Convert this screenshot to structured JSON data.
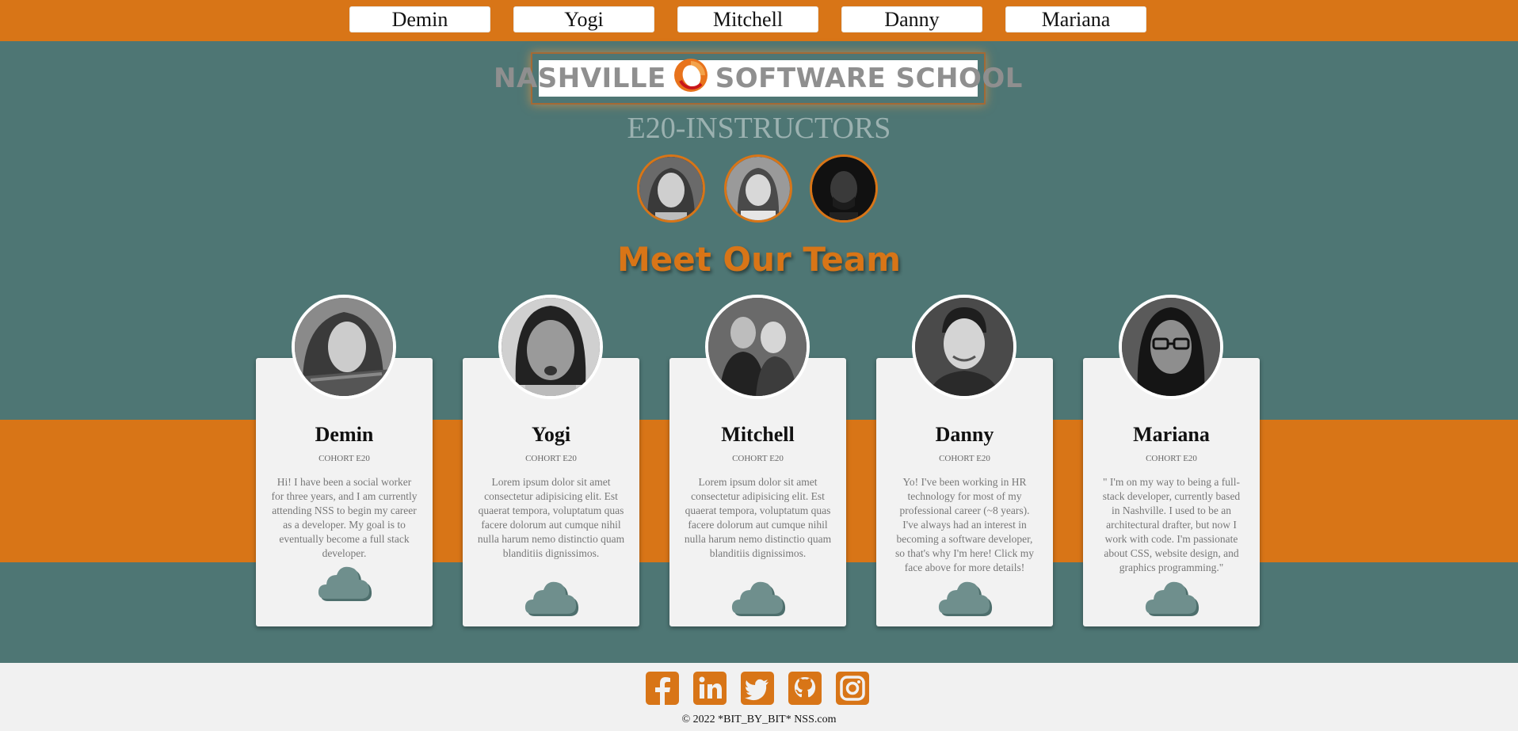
{
  "nav": {
    "items": [
      {
        "label": "Demin"
      },
      {
        "label": "Yogi"
      },
      {
        "label": "Mitchell"
      },
      {
        "label": "Danny"
      },
      {
        "label": "Mariana"
      }
    ]
  },
  "logo": {
    "left_text": "NASHVILLE",
    "right_text": "SOFTWARE SCHOOL"
  },
  "instructors": {
    "title": "E20-INSTRUCTORS",
    "count": 3
  },
  "team": {
    "title": "Meet Our Team",
    "members": [
      {
        "name": "Demin",
        "cohort": "COHORT E20",
        "bio": "Hi! I have been a social worker for three years, and I am currently attending NSS to begin my career as a developer. My goal is to eventually become a full stack developer."
      },
      {
        "name": "Yogi",
        "cohort": "COHORT E20",
        "bio": "Lorem ipsum dolor sit amet consectetur adipisicing elit. Est quaerat tempora, voluptatum quas facere dolorum aut cumque nihil nulla harum nemo distinctio quam blanditiis dignissimos."
      },
      {
        "name": "Mitchell",
        "cohort": "COHORT E20",
        "bio": "Lorem ipsum dolor sit amet consectetur adipisicing elit. Est quaerat tempora, voluptatum quas facere dolorum aut cumque nihil nulla harum nemo distinctio quam blanditiis dignissimos."
      },
      {
        "name": "Danny",
        "cohort": "COHORT E20",
        "bio": "Yo! I've been working in HR technology for most of my professional career (~8 years). I've always had an interest in becoming a software developer, so that's why I'm here! Click my face above for more details!"
      },
      {
        "name": "Mariana",
        "cohort": "COHORT E20",
        "bio": "\" I'm on my way to being a full-stack developer, currently based in Nashville. I used to be an architectural drafter, but now I work with code. I'm passionate about CSS, website design, and graphics programming.\""
      }
    ]
  },
  "footer": {
    "social": [
      "facebook-icon",
      "linkedin-icon",
      "twitter-icon",
      "github-icon",
      "instagram-icon"
    ],
    "copyright": "© 2022 *BIT_BY_BIT* NSS.com"
  },
  "colors": {
    "accent": "#d87517",
    "background": "#4e7674",
    "card": "#f2f2f2",
    "cloud": "#6f8f8d",
    "footer": "#f1f1f1"
  }
}
